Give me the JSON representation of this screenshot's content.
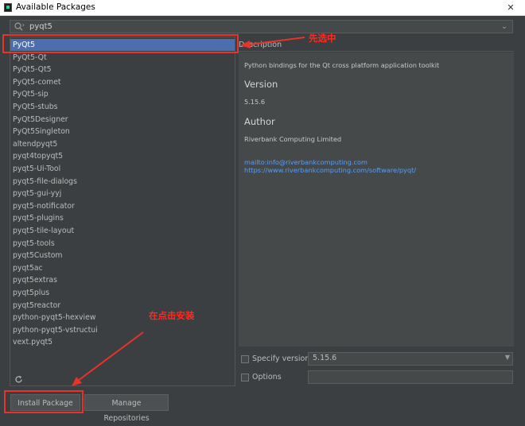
{
  "window": {
    "title": "Available Packages",
    "close_glyph": "✕"
  },
  "search": {
    "value": "pyqt5"
  },
  "packages": {
    "items": [
      "PyQt5",
      "PyQt5-Qt",
      "PyQt5-Qt5",
      "PyQt5-comet",
      "PyQt5-sip",
      "PyQt5-stubs",
      "PyQt5Designer",
      "PyQt5Singleton",
      "altendpyqt5",
      "pyqt4topyqt5",
      "pyqt5-Ui-Tool",
      "pyqt5-file-dialogs",
      "pyqt5-gui-yyj",
      "pyqt5-notificator",
      "pyqt5-plugins",
      "pyqt5-tile-layout",
      "pyqt5-tools",
      "pyqt5Custom",
      "pyqt5ac",
      "pyqt5extras",
      "pyqt5plus",
      "pyqt5reactor",
      "python-pyqt5-hexview",
      "python-pyqt5-vstructui",
      "vext.pyqt5"
    ],
    "selected_index": 0
  },
  "description": {
    "header": "Description",
    "summary": "Python bindings for the Qt cross platform application toolkit",
    "version_heading": "Version",
    "version_value": "5.15.6",
    "author_heading": "Author",
    "author_value": "Riverbank Computing Limited",
    "mail_link": "mailto:info@riverbankcomputing.com",
    "web_link": "https://www.riverbankcomputing.com/software/pyqt/"
  },
  "options": {
    "specify_version_label": "Specify version",
    "specify_version_value": "5.15.6",
    "options_label": "Options"
  },
  "buttons": {
    "install": "Install Package",
    "manage": "Manage Repositories"
  },
  "annotations": {
    "select_first": "先选中",
    "then_install": "在点击安装"
  },
  "colors": {
    "selection": "#4b6eaf",
    "annotation_red": "#e8322a",
    "link": "#589df6",
    "background": "#3c3f41"
  }
}
